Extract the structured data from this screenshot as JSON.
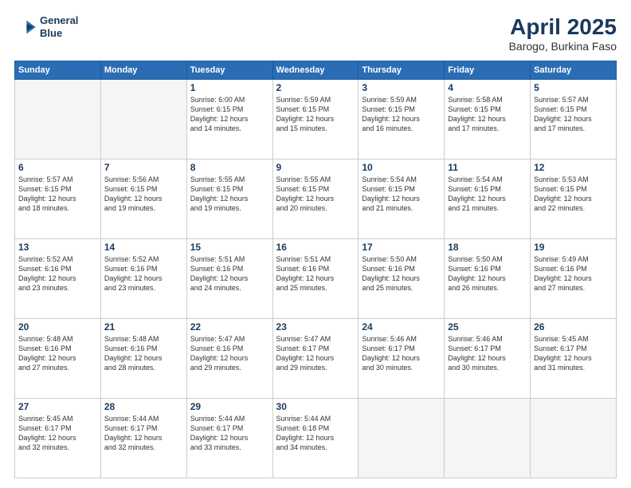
{
  "logo": {
    "line1": "General",
    "line2": "Blue"
  },
  "title": "April 2025",
  "subtitle": "Barogo, Burkina Faso",
  "days_header": [
    "Sunday",
    "Monday",
    "Tuesday",
    "Wednesday",
    "Thursday",
    "Friday",
    "Saturday"
  ],
  "weeks": [
    [
      {
        "num": "",
        "text": ""
      },
      {
        "num": "",
        "text": ""
      },
      {
        "num": "1",
        "text": "Sunrise: 6:00 AM\nSunset: 6:15 PM\nDaylight: 12 hours\nand 14 minutes."
      },
      {
        "num": "2",
        "text": "Sunrise: 5:59 AM\nSunset: 6:15 PM\nDaylight: 12 hours\nand 15 minutes."
      },
      {
        "num": "3",
        "text": "Sunrise: 5:59 AM\nSunset: 6:15 PM\nDaylight: 12 hours\nand 16 minutes."
      },
      {
        "num": "4",
        "text": "Sunrise: 5:58 AM\nSunset: 6:15 PM\nDaylight: 12 hours\nand 17 minutes."
      },
      {
        "num": "5",
        "text": "Sunrise: 5:57 AM\nSunset: 6:15 PM\nDaylight: 12 hours\nand 17 minutes."
      }
    ],
    [
      {
        "num": "6",
        "text": "Sunrise: 5:57 AM\nSunset: 6:15 PM\nDaylight: 12 hours\nand 18 minutes."
      },
      {
        "num": "7",
        "text": "Sunrise: 5:56 AM\nSunset: 6:15 PM\nDaylight: 12 hours\nand 19 minutes."
      },
      {
        "num": "8",
        "text": "Sunrise: 5:55 AM\nSunset: 6:15 PM\nDaylight: 12 hours\nand 19 minutes."
      },
      {
        "num": "9",
        "text": "Sunrise: 5:55 AM\nSunset: 6:15 PM\nDaylight: 12 hours\nand 20 minutes."
      },
      {
        "num": "10",
        "text": "Sunrise: 5:54 AM\nSunset: 6:15 PM\nDaylight: 12 hours\nand 21 minutes."
      },
      {
        "num": "11",
        "text": "Sunrise: 5:54 AM\nSunset: 6:15 PM\nDaylight: 12 hours\nand 21 minutes."
      },
      {
        "num": "12",
        "text": "Sunrise: 5:53 AM\nSunset: 6:15 PM\nDaylight: 12 hours\nand 22 minutes."
      }
    ],
    [
      {
        "num": "13",
        "text": "Sunrise: 5:52 AM\nSunset: 6:16 PM\nDaylight: 12 hours\nand 23 minutes."
      },
      {
        "num": "14",
        "text": "Sunrise: 5:52 AM\nSunset: 6:16 PM\nDaylight: 12 hours\nand 23 minutes."
      },
      {
        "num": "15",
        "text": "Sunrise: 5:51 AM\nSunset: 6:16 PM\nDaylight: 12 hours\nand 24 minutes."
      },
      {
        "num": "16",
        "text": "Sunrise: 5:51 AM\nSunset: 6:16 PM\nDaylight: 12 hours\nand 25 minutes."
      },
      {
        "num": "17",
        "text": "Sunrise: 5:50 AM\nSunset: 6:16 PM\nDaylight: 12 hours\nand 25 minutes."
      },
      {
        "num": "18",
        "text": "Sunrise: 5:50 AM\nSunset: 6:16 PM\nDaylight: 12 hours\nand 26 minutes."
      },
      {
        "num": "19",
        "text": "Sunrise: 5:49 AM\nSunset: 6:16 PM\nDaylight: 12 hours\nand 27 minutes."
      }
    ],
    [
      {
        "num": "20",
        "text": "Sunrise: 5:48 AM\nSunset: 6:16 PM\nDaylight: 12 hours\nand 27 minutes."
      },
      {
        "num": "21",
        "text": "Sunrise: 5:48 AM\nSunset: 6:16 PM\nDaylight: 12 hours\nand 28 minutes."
      },
      {
        "num": "22",
        "text": "Sunrise: 5:47 AM\nSunset: 6:16 PM\nDaylight: 12 hours\nand 29 minutes."
      },
      {
        "num": "23",
        "text": "Sunrise: 5:47 AM\nSunset: 6:17 PM\nDaylight: 12 hours\nand 29 minutes."
      },
      {
        "num": "24",
        "text": "Sunrise: 5:46 AM\nSunset: 6:17 PM\nDaylight: 12 hours\nand 30 minutes."
      },
      {
        "num": "25",
        "text": "Sunrise: 5:46 AM\nSunset: 6:17 PM\nDaylight: 12 hours\nand 30 minutes."
      },
      {
        "num": "26",
        "text": "Sunrise: 5:45 AM\nSunset: 6:17 PM\nDaylight: 12 hours\nand 31 minutes."
      }
    ],
    [
      {
        "num": "27",
        "text": "Sunrise: 5:45 AM\nSunset: 6:17 PM\nDaylight: 12 hours\nand 32 minutes."
      },
      {
        "num": "28",
        "text": "Sunrise: 5:44 AM\nSunset: 6:17 PM\nDaylight: 12 hours\nand 32 minutes."
      },
      {
        "num": "29",
        "text": "Sunrise: 5:44 AM\nSunset: 6:17 PM\nDaylight: 12 hours\nand 33 minutes."
      },
      {
        "num": "30",
        "text": "Sunrise: 5:44 AM\nSunset: 6:18 PM\nDaylight: 12 hours\nand 34 minutes."
      },
      {
        "num": "",
        "text": ""
      },
      {
        "num": "",
        "text": ""
      },
      {
        "num": "",
        "text": ""
      }
    ]
  ]
}
